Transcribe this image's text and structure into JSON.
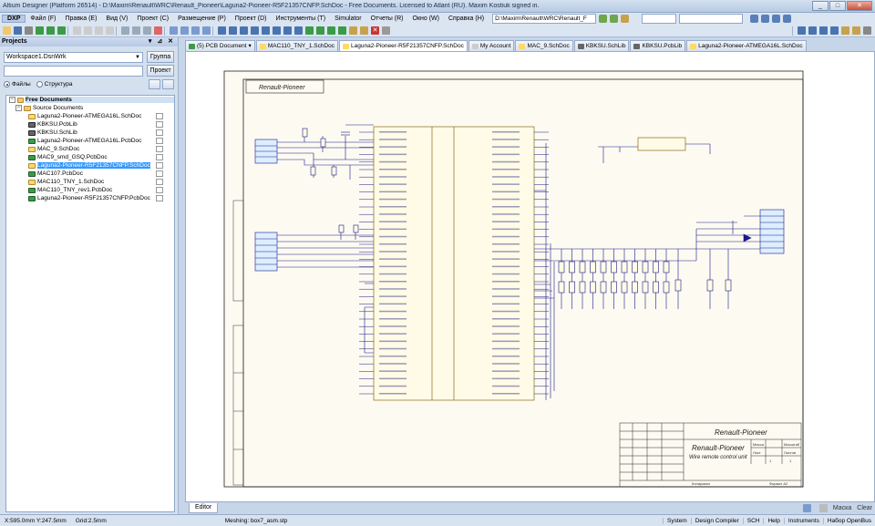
{
  "window": {
    "title": "Altium Designer (Platform 26514) - D:\\Maxim\\Renault\\WRC\\Renault_Pioneer\\Laguna2-Pioneer-R5F21357CNFP.SchDoc - Free Documents. Licensed to Atlant (RU). Maxim Kostiuk signed in.",
    "minimize": "_",
    "maximize": "□",
    "close": "✕"
  },
  "menu": {
    "dxp": "DXP",
    "items": [
      "Файл (F)",
      "Правка (E)",
      "Вид (V)",
      "Проект (C)",
      "Размещение (P)",
      "Проект (D)",
      "Инструменты (T)",
      "Simulator",
      "Отчеты (R)",
      "Окно (W)",
      "Справка (H)"
    ],
    "path": "D:\\Maxim\\Renault\\WRC\\Renault_F"
  },
  "panel": {
    "title": "Projects",
    "header_buttons": "▾ ⊿ ✕",
    "workspace": "Workspace1.DsnWrk",
    "group_button": "Группа",
    "project_input": "",
    "project_button": "Проект",
    "view_files": "Файлы",
    "view_structure": "Структура"
  },
  "tree": {
    "root": "Free Documents",
    "folder": "Source Documents",
    "files": [
      {
        "name": "Laguna2-Pioneer-ATMEGA16L.SchDoc",
        "type": "sch"
      },
      {
        "name": "KBKSU.PcbLib",
        "type": "lib"
      },
      {
        "name": "KBKSU.SchLib",
        "type": "lib"
      },
      {
        "name": "Laguna2-Pioneer-ATMEGA16L.PcbDoc",
        "type": "pcb"
      },
      {
        "name": "MAC_9.SchDoc",
        "type": "sch"
      },
      {
        "name": "MAC9_smd_GSQ.PcbDoc",
        "type": "pcb"
      },
      {
        "name": "Laguna2-Pioneer-R5F21357CNFP.SchDoc",
        "type": "sch",
        "selected": true
      },
      {
        "name": "MAC107.PcbDoc",
        "type": "pcb"
      },
      {
        "name": "MAC110_TNY_1.SchDoc",
        "type": "sch"
      },
      {
        "name": "MAC110_TNY_rev1.PcbDoc",
        "type": "pcb"
      },
      {
        "name": "Laguna2-Pioneer-R5F21357CNFP.PcbDoc",
        "type": "pcb"
      }
    ]
  },
  "doc_tabs": [
    {
      "label": "(5) PCB Document",
      "icon": "pcb",
      "dropdown": "▾"
    },
    {
      "label": "MAC110_TNY_1.SchDoc",
      "icon": "sch"
    },
    {
      "label": "Laguna2-Pioneer-R5F21357CNFP.SchDoc",
      "icon": "sch",
      "active": true
    },
    {
      "label": "My Account",
      "icon": "doc"
    },
    {
      "label": "MAC_9.SchDoc",
      "icon": "sch"
    },
    {
      "label": "KBKSU.SchLib",
      "icon": "lib"
    },
    {
      "label": "KBKSU.PcbLib",
      "icon": "lib"
    },
    {
      "label": "Laguna2-Pioneer-ATMEGA16L.SchDoc",
      "icon": "sch"
    }
  ],
  "sheet": {
    "top_label": "Renault-Pioneer",
    "title_main": "Renault-Pioneer",
    "title_sub_1": "Renault-Pioneer",
    "title_sub_2": "Wire remote control unit",
    "copied": "Копировал",
    "format": "Формат A2",
    "mass": "Масса",
    "scale": "Масштаб",
    "sheet_label": "Лист",
    "sheets_label": "Листов",
    "scale_value": "1",
    "sheets_value": "1"
  },
  "editor": {
    "tab": "Editor",
    "right_items": [
      "Маска",
      "Clear"
    ]
  },
  "status": {
    "coords": "X:595.0mm Y:247.5mm",
    "grid": "Grid:2.5mm",
    "meshing": "Meshing: box7_asm.stp",
    "buttons": [
      "System",
      "Design Compiler",
      "SCH",
      "Help",
      "Instruments",
      "Набор OpenBus"
    ]
  },
  "colors": {
    "accent_select": "#3399ff",
    "chrome": "#c7d5e8",
    "wire": "#1a1a8c"
  }
}
